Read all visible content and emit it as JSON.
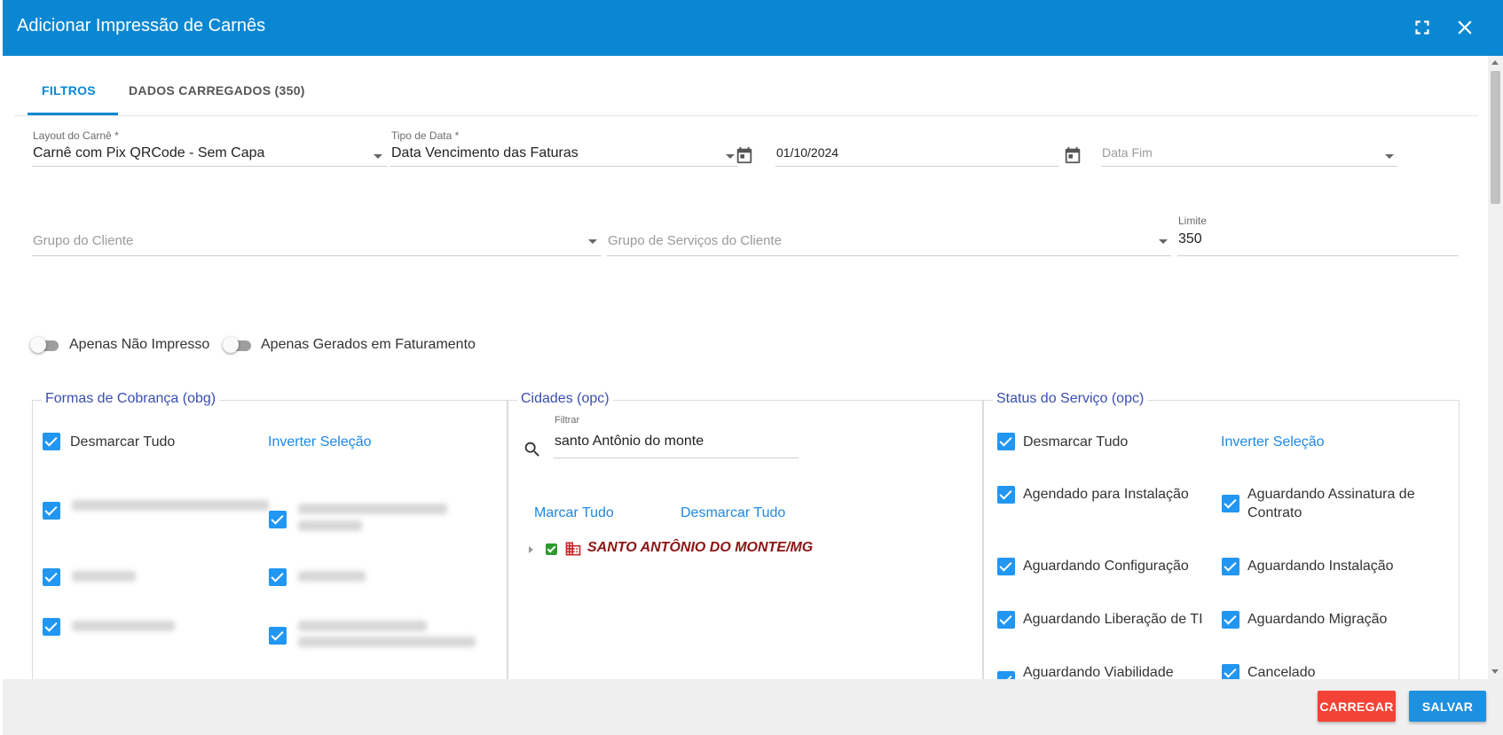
{
  "window": {
    "title": "Adicionar Impressão de Carnês",
    "icons": [
      "fullscreen-icon",
      "close-icon"
    ]
  },
  "tabs": [
    {
      "label": "FILTROS",
      "active": true
    },
    {
      "label": "DADOS CARREGADOS (350)",
      "active": false
    }
  ],
  "filters": {
    "layout": {
      "label": "Layout do Carnê *",
      "value": "Carnê com Pix QRCode - Sem Capa"
    },
    "tipo_data": {
      "label": "Tipo de Data *",
      "value": "Data Vencimento das Faturas"
    },
    "data_inicio": {
      "value": "01/10/2024"
    },
    "data_fim": {
      "placeholder": "Data Fim"
    },
    "grupo_cliente": {
      "placeholder": "Grupo do Cliente"
    },
    "grupo_servicos": {
      "placeholder": "Grupo de Serviços do Cliente"
    },
    "limite": {
      "label": "Limite",
      "value": "350"
    }
  },
  "toggles": [
    {
      "label": "Apenas Não Impresso",
      "on": false
    },
    {
      "label": "Apenas Gerados em Faturamento",
      "on": false
    }
  ],
  "formas_cobranca": {
    "title": "Formas de Cobrança (obg)",
    "desmarcar": "Desmarcar Tudo",
    "inverter": "Inverter Seleção"
  },
  "cidades": {
    "title": "Cidades (opc)",
    "filter_label": "Filtrar",
    "filter_value": "santo Antônio do monte",
    "marcar": "Marcar Tudo",
    "desmarcar": "Desmarcar Tudo",
    "tree_item": "SANTO ANTÔNIO DO MONTE/MG"
  },
  "status_servico": {
    "title": "Status do Serviço (opc)",
    "desmarcar": "Desmarcar Tudo",
    "inverter": "Inverter Seleção",
    "items": [
      "Agendado para Instalação",
      "Aguardando Assinatura de Contrato",
      "Aguardando Configuração",
      "Aguardando Instalação",
      "Aguardando Liberação de TI",
      "Aguardando Migração",
      "Aguardando Viabilidade",
      "Cancelado"
    ]
  },
  "footer": {
    "carregar": "CARREGAR",
    "salvar": "SALVAR"
  },
  "colors": {
    "header": "#0a87d2",
    "checkbox": "#2196f3",
    "carregar_button": "#f44336",
    "salvar_button": "#1e90e0",
    "panel_title": "#3a4db3",
    "city": "#8b1515"
  }
}
